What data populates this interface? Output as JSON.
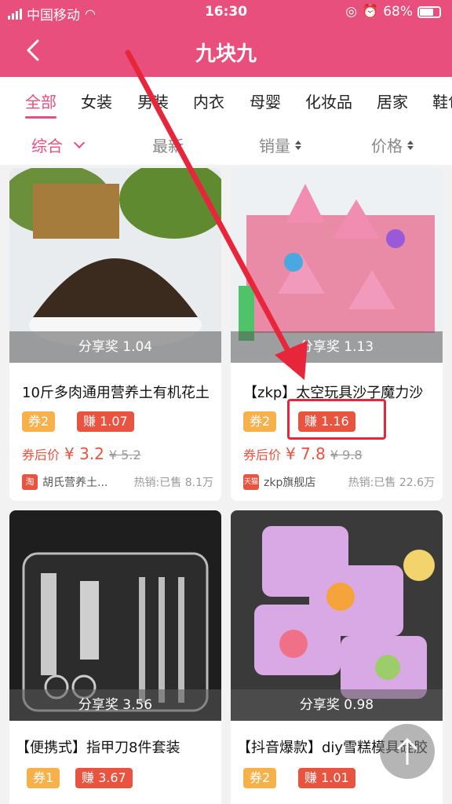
{
  "status": {
    "carrier": "中国移动",
    "time": "16:30",
    "battery": "68%"
  },
  "nav": {
    "title": "九块九"
  },
  "tabs": [
    "全部",
    "女装",
    "男装",
    "内衣",
    "母婴",
    "化妆品",
    "居家",
    "鞋包"
  ],
  "sort": [
    "综合",
    "最新",
    "销量",
    "价格"
  ],
  "products": [
    {
      "title": "10斤多肉通用营养土有机花土",
      "share": "分享奖 1.04",
      "coupon": "券2",
      "earn": "赚 1.07",
      "price_label": "券后价",
      "price": "¥ 3.2",
      "old_price": "¥ 5.2",
      "shop_tag": "淘",
      "shop": "胡氏营养土...",
      "sales": "热销:已售 8.1万"
    },
    {
      "title": "【zkp】太空玩具沙子魔力沙",
      "share": "分享奖 1.13",
      "coupon": "券2",
      "earn": "赚 1.16",
      "price_label": "券后价",
      "price": "¥ 7.8",
      "old_price": "¥ 9.8",
      "shop_tag": "天猫",
      "shop": "zkp旗舰店",
      "sales": "热销:已售 22.6万"
    },
    {
      "title": "【便携式】指甲刀8件套装",
      "share": "分享奖 3.56",
      "coupon": "券1",
      "earn": "赚 3.67"
    },
    {
      "title": "【抖音爆款】diy雪糕模具硅胶",
      "share": "分享奖 0.98",
      "coupon": "券2",
      "earn": "赚 1.01"
    }
  ]
}
